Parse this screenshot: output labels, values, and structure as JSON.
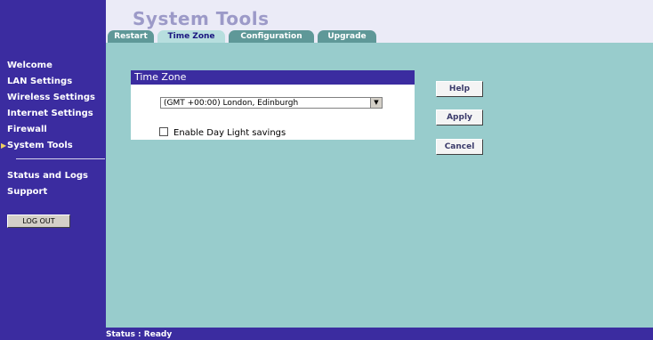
{
  "header": {
    "title": "System Tools"
  },
  "tabs": [
    {
      "label": "Restart",
      "active": false
    },
    {
      "label": "Time Zone",
      "active": true
    },
    {
      "label": "Configuration",
      "active": false
    },
    {
      "label": "Upgrade",
      "active": false
    }
  ],
  "sidebar": {
    "items": [
      {
        "label": "Welcome"
      },
      {
        "label": "LAN Settings"
      },
      {
        "label": "Wireless Settings"
      },
      {
        "label": "Internet Settings"
      },
      {
        "label": "Firewall"
      },
      {
        "label": "System Tools",
        "current": true
      }
    ],
    "items2": [
      {
        "label": "Status and Logs"
      },
      {
        "label": "Support"
      }
    ],
    "logout_label": "LOG OUT"
  },
  "panel": {
    "title": "Time Zone",
    "timezone_value": "(GMT +00:00) London, Edinburgh",
    "dst_label": "Enable Day Light savings",
    "dst_checked": false
  },
  "buttons": {
    "help": "Help",
    "apply": "Apply",
    "cancel": "Cancel"
  },
  "status": {
    "text": "Status : Ready"
  },
  "colors": {
    "nav_bg": "#3b2ca0",
    "content_bg": "#98cccc",
    "tab_bg": "#5f9898"
  }
}
